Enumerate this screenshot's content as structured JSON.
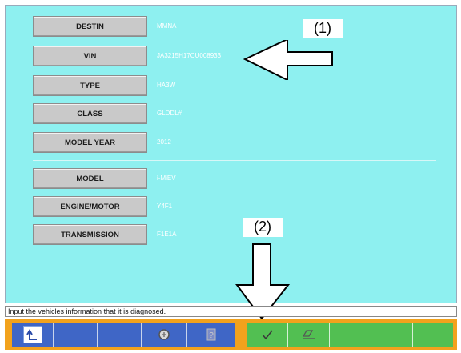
{
  "fields": [
    {
      "label": "DESTIN",
      "value": "MMNA"
    },
    {
      "label": "VIN",
      "value": "JA3215H17CU008933"
    },
    {
      "label": "TYPE",
      "value": "HA3W"
    },
    {
      "label": "CLASS",
      "value": "GLDDL#"
    },
    {
      "label": "MODEL YEAR",
      "value": "2012"
    },
    {
      "label": "MODEL",
      "value": "i-MiEV"
    },
    {
      "label": "ENGINE/MOTOR",
      "value": "Y4F1"
    },
    {
      "label": "TRANSMISSION",
      "value": "F1E1A"
    }
  ],
  "callouts": {
    "one": "(1)",
    "two": "(2)"
  },
  "status_text": "Input the vehicles information that it is diagnosed.",
  "toolbar": {
    "left_icons": [
      "back-arrow-icon",
      "printer-icon",
      "help-icon"
    ],
    "right_icons": [
      "checkmark-icon",
      "eraser-icon"
    ]
  },
  "colors": {
    "background": "#8ef0f0",
    "toolbar": "#f2a21d",
    "left_group": "#3f66c6",
    "right_group": "#52bf52"
  }
}
